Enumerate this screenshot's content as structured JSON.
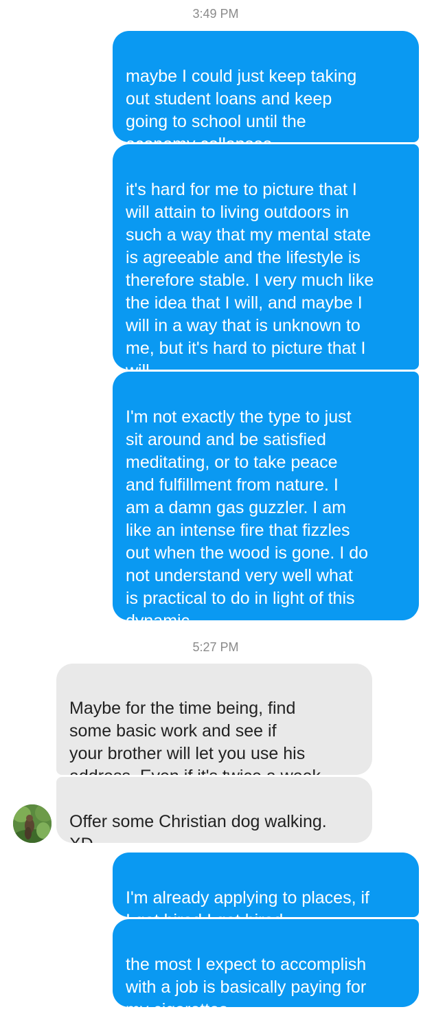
{
  "thread": {
    "timestamps": [
      "3:49 PM",
      "5:27 PM"
    ],
    "messages": [
      {
        "direction": "outgoing",
        "text": "maybe I could just keep taking\nout student loans and keep\ngoing to school until the\neconomy collapses."
      },
      {
        "direction": "outgoing",
        "text": "it's hard for me to picture that I\nwill attain to living outdoors in\nsuch a way that my mental state\nis agreeable and the lifestyle is\ntherefore stable. I very much like\nthe idea that I will, and maybe I\nwill in a way that is unknown to\nme, but it's hard to picture that I\nwill."
      },
      {
        "direction": "outgoing",
        "text": "I'm not exactly the type to just\nsit around and be satisfied\nmeditating, or to take peace\nand fulfillment from nature. I\nam a damn gas guzzler. I am\nlike an intense fire that fizzles\nout when the wood is gone. I do\nnot understand very well what\nis practical to do in light of this\ndynamic."
      },
      {
        "direction": "incoming",
        "text": "Maybe for the time being, find\nsome basic work and see if\nyour brother will let you use his\naddress. Even if it's twice a week."
      },
      {
        "direction": "incoming",
        "text": "Offer some Christian dog walking.\nXD"
      },
      {
        "direction": "outgoing",
        "text": "I'm already applying to places, if\nI get hired I get hired."
      },
      {
        "direction": "outgoing",
        "text": "the most I expect to accomplish\nwith a job is basically paying for\nmy cigarettes."
      }
    ]
  },
  "contact": {
    "avatar_icon": "contact-avatar-photo"
  },
  "colors": {
    "outgoing_bubble": "#0a99f2",
    "incoming_bubble": "#e9e9e9",
    "timestamp_text": "#8a8a8a"
  }
}
